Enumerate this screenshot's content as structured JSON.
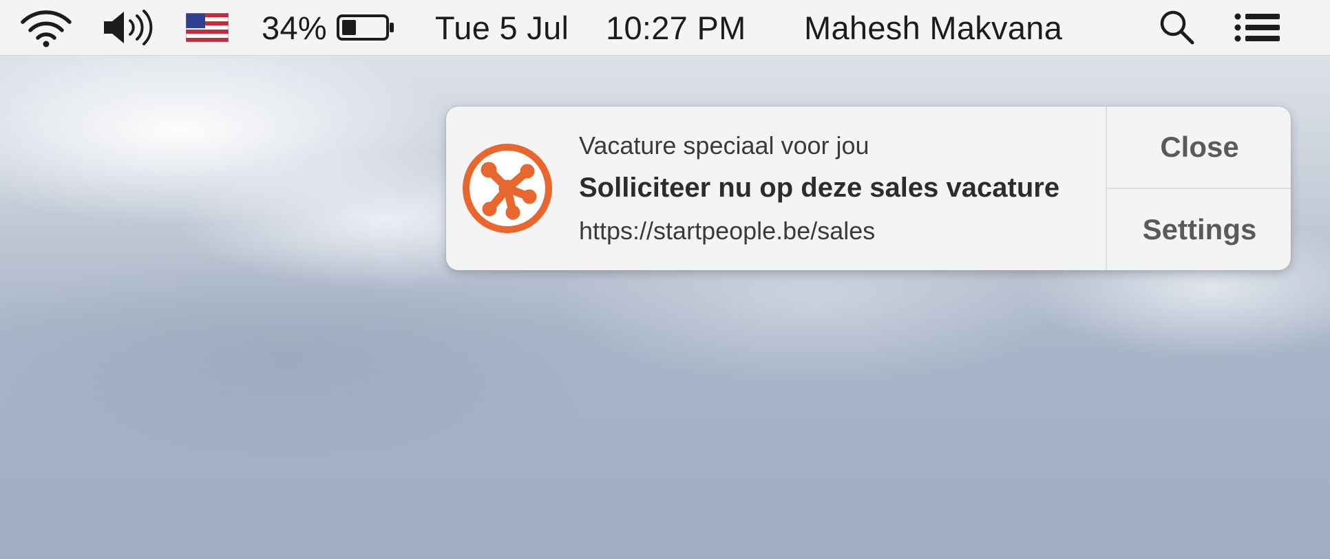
{
  "menubar": {
    "items": [
      {
        "name": "wifi-icon"
      },
      {
        "name": "volume-icon"
      },
      {
        "name": "flag-us-icon"
      },
      {
        "name": "battery-icon"
      },
      {
        "name": "search-icon"
      },
      {
        "name": "notification-center-icon"
      }
    ],
    "battery_percent": "34%",
    "battery_level": 0.34,
    "date": "Tue 5 Jul",
    "time": "10:27 PM",
    "user_name": "Mahesh Makvana"
  },
  "notification": {
    "app_icon": "startpeople-logo-icon",
    "accent_color": "#e8672e",
    "subtitle": "Vacature speciaal voor jou",
    "title": "Solliciteer nu op deze sales vacature",
    "body": "https://startpeople.be/sales",
    "actions": {
      "close_label": "Close",
      "settings_label": "Settings"
    }
  }
}
